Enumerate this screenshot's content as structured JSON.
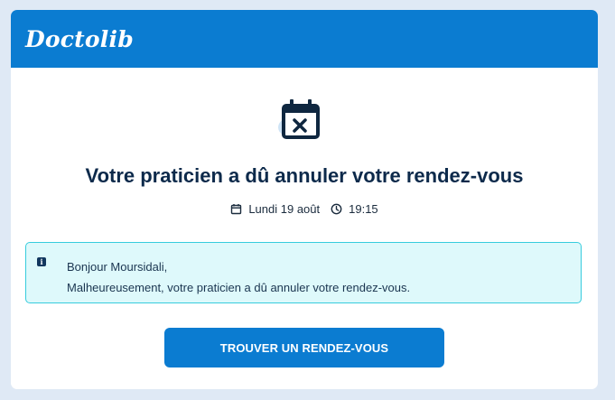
{
  "header": {
    "logo_text": "Doctolib",
    "background_color": "#0b7cd1"
  },
  "hero": {
    "icon": "calendar-cancel-icon",
    "title": "Votre praticien a dû annuler votre rendez-vous"
  },
  "appointment": {
    "date_icon": "calendar-icon",
    "date": "Lundi 19 août",
    "time_icon": "clock-icon",
    "time": "19:15"
  },
  "notice": {
    "icon": "info-icon",
    "greeting": "Bonjour Moursidali,",
    "message": "Malheureusement, votre praticien a dû annuler votre rendez-vous.",
    "background_color": "#def9fb",
    "border_color": "#37ccdd"
  },
  "cta": {
    "label": "TROUVER UN RENDEZ-VOUS",
    "color": "#0b7cd1"
  }
}
